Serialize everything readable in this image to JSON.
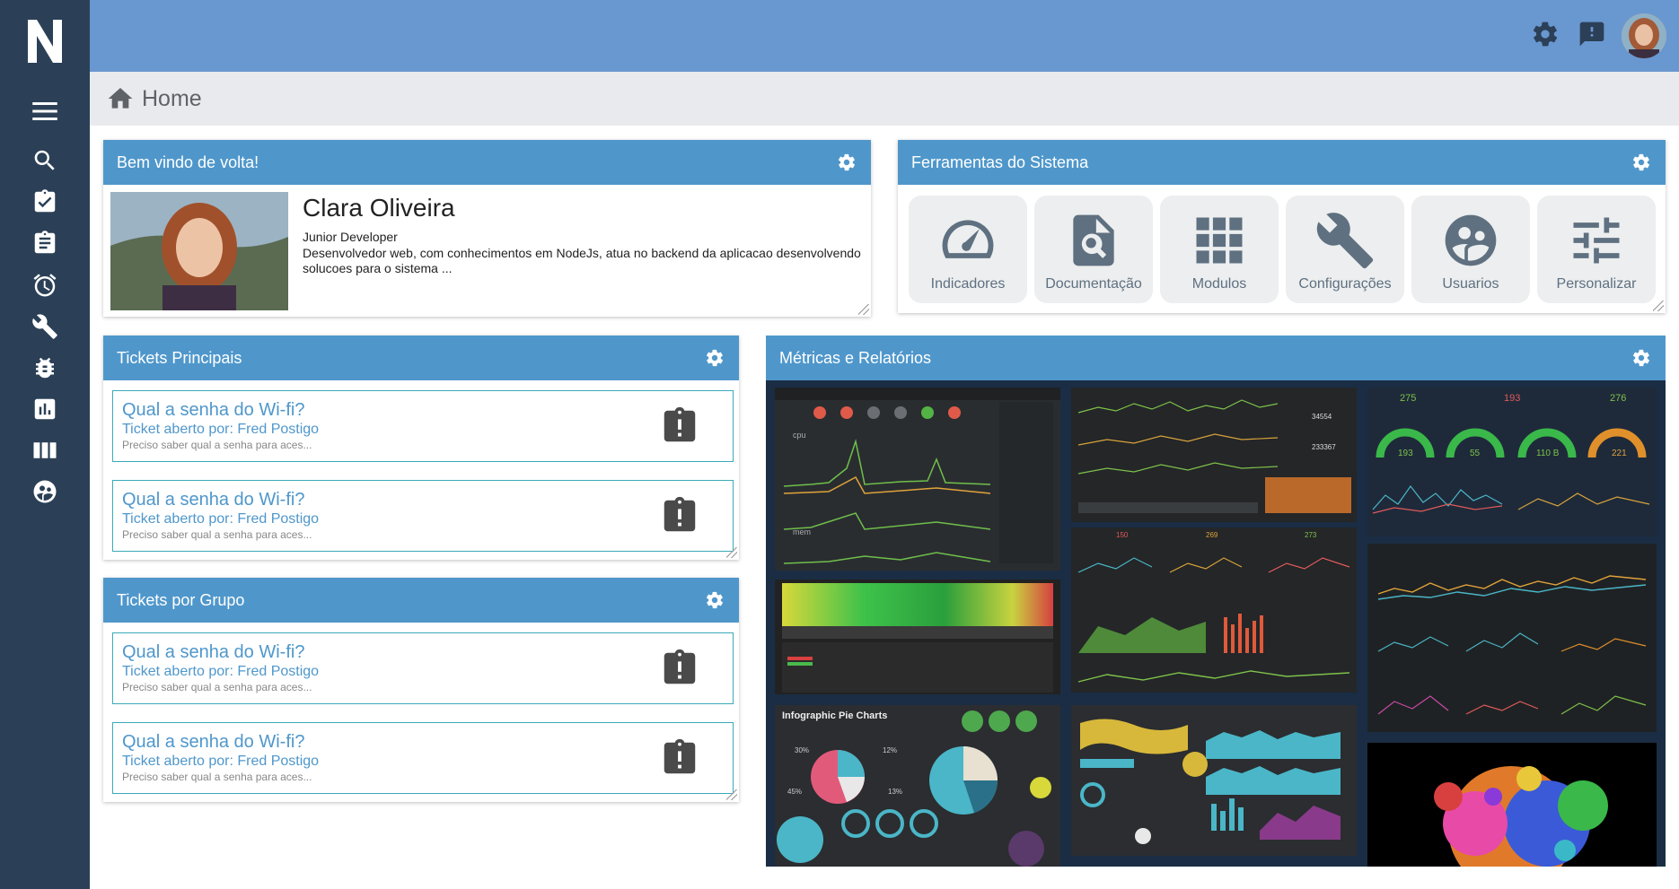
{
  "app": {
    "logo_letter": "N"
  },
  "sidebar": {
    "items": [
      {
        "name": "menu",
        "icon": "menu-icon"
      },
      {
        "name": "search",
        "icon": "search-icon"
      },
      {
        "name": "tasks",
        "icon": "clipboard-check-icon"
      },
      {
        "name": "reports",
        "icon": "clipboard-text-icon"
      },
      {
        "name": "alarms",
        "icon": "alarm-clock-icon"
      },
      {
        "name": "tools",
        "icon": "wrench-icon"
      },
      {
        "name": "bugs",
        "icon": "bug-icon"
      },
      {
        "name": "charts",
        "icon": "bar-chart-icon"
      },
      {
        "name": "columns",
        "icon": "columns-icon"
      },
      {
        "name": "users",
        "icon": "users-circle-icon"
      }
    ]
  },
  "header": {
    "icons": [
      "gear-icon",
      "feedback-icon",
      "avatar"
    ]
  },
  "breadcrumb": {
    "label": "Home"
  },
  "welcome": {
    "title": "Bem vindo de volta!",
    "name": "Clara Oliveira",
    "role": "Junior Developer",
    "description": "Desenvolvedor web, com conhecimentos em NodeJs, atua no backend da aplicacao desenvolvendo solucoes para o sistema ..."
  },
  "tools": {
    "title": "Ferramentas do Sistema",
    "items": [
      {
        "label": "Indicadores",
        "icon": "speedometer-icon"
      },
      {
        "label": "Documentação",
        "icon": "file-search-icon"
      },
      {
        "label": "Modulos",
        "icon": "grid-icon"
      },
      {
        "label": "Configurações",
        "icon": "wrench-icon"
      },
      {
        "label": "Usuarios",
        "icon": "users-circle-icon"
      },
      {
        "label": "Personalizar",
        "icon": "sliders-icon"
      }
    ]
  },
  "tickets_main": {
    "title": "Tickets Principais",
    "items": [
      {
        "title": "Qual a senha do Wi-fi?",
        "by": "Ticket aberto por: Fred Postigo",
        "desc": "Preciso saber qual a senha para aces..."
      },
      {
        "title": "Qual a senha do Wi-fi?",
        "by": "Ticket aberto por: Fred Postigo",
        "desc": "Preciso saber qual a senha para aces..."
      }
    ]
  },
  "tickets_group": {
    "title": "Tickets por Grupo",
    "items": [
      {
        "title": "Qual a senha do Wi-fi?",
        "by": "Ticket aberto por: Fred Postigo",
        "desc": "Preciso saber qual a senha para aces..."
      },
      {
        "title": "Qual a senha do Wi-fi?",
        "by": "Ticket aberto por: Fred Postigo",
        "desc": "Preciso saber qual a senha para aces..."
      }
    ]
  },
  "metrics": {
    "title": "Métricas e Relatórios",
    "thumb_labels": {
      "cpu": "cpu",
      "mem": "mem",
      "pie_title": "Infographic Pie Charts",
      "stat_1": "34554",
      "stat_2": "233367",
      "g1": "275",
      "g2": "193",
      "g3": "276",
      "d1": "193",
      "d2": "55",
      "d3": "110 B",
      "d4": "221",
      "n1": "150",
      "n2": "269",
      "n3": "273",
      "p1": "30%",
      "p2": "12%",
      "p3": "45%",
      "p4": "13%"
    }
  },
  "colors": {
    "sidebar": "#2b4057",
    "header": "#6997d0",
    "panel_head": "#4f97cb",
    "ticket_border": "#3aaab8"
  }
}
